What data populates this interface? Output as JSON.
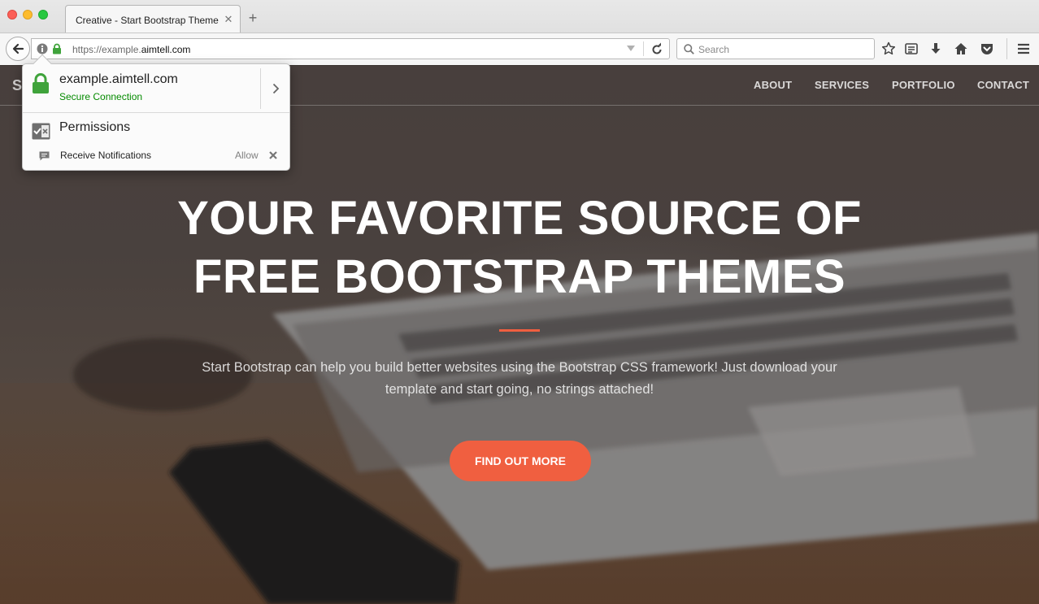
{
  "browser": {
    "tab": {
      "title": "Creative - Start Bootstrap Theme",
      "close_glyph": "✕"
    },
    "new_tab_glyph": "+",
    "url": {
      "prefix": "https://example.",
      "domain": "aimtell.com"
    },
    "search": {
      "placeholder": "Search"
    },
    "icons": [
      "back-arrow-icon",
      "site-info-icon",
      "lock-icon",
      "url-dropdown-icon",
      "reload-icon",
      "search-icon",
      "bookmark-star-icon",
      "reading-list-icon",
      "download-icon",
      "home-icon",
      "pocket-icon",
      "hamburger-menu-icon"
    ]
  },
  "popup": {
    "host": "example.aimtell.com",
    "status": "Secure Connection",
    "permissions_title": "Permissions",
    "permission": {
      "label": "Receive Notifications",
      "state": "Allow"
    },
    "status_color": "#058b00"
  },
  "site": {
    "brand": "S",
    "nav": [
      "ABOUT",
      "SERVICES",
      "PORTFOLIO",
      "CONTACT"
    ],
    "hero": {
      "title_line1": "YOUR FAVORITE SOURCE OF",
      "title_line2": "FREE BOOTSTRAP THEMES",
      "subtitle": "Start Bootstrap can help you build better websites using the Bootstrap CSS framework! Just download your template and start going, no strings attached!",
      "cta": "FIND OUT MORE"
    },
    "accent_color": "#f05f40"
  }
}
